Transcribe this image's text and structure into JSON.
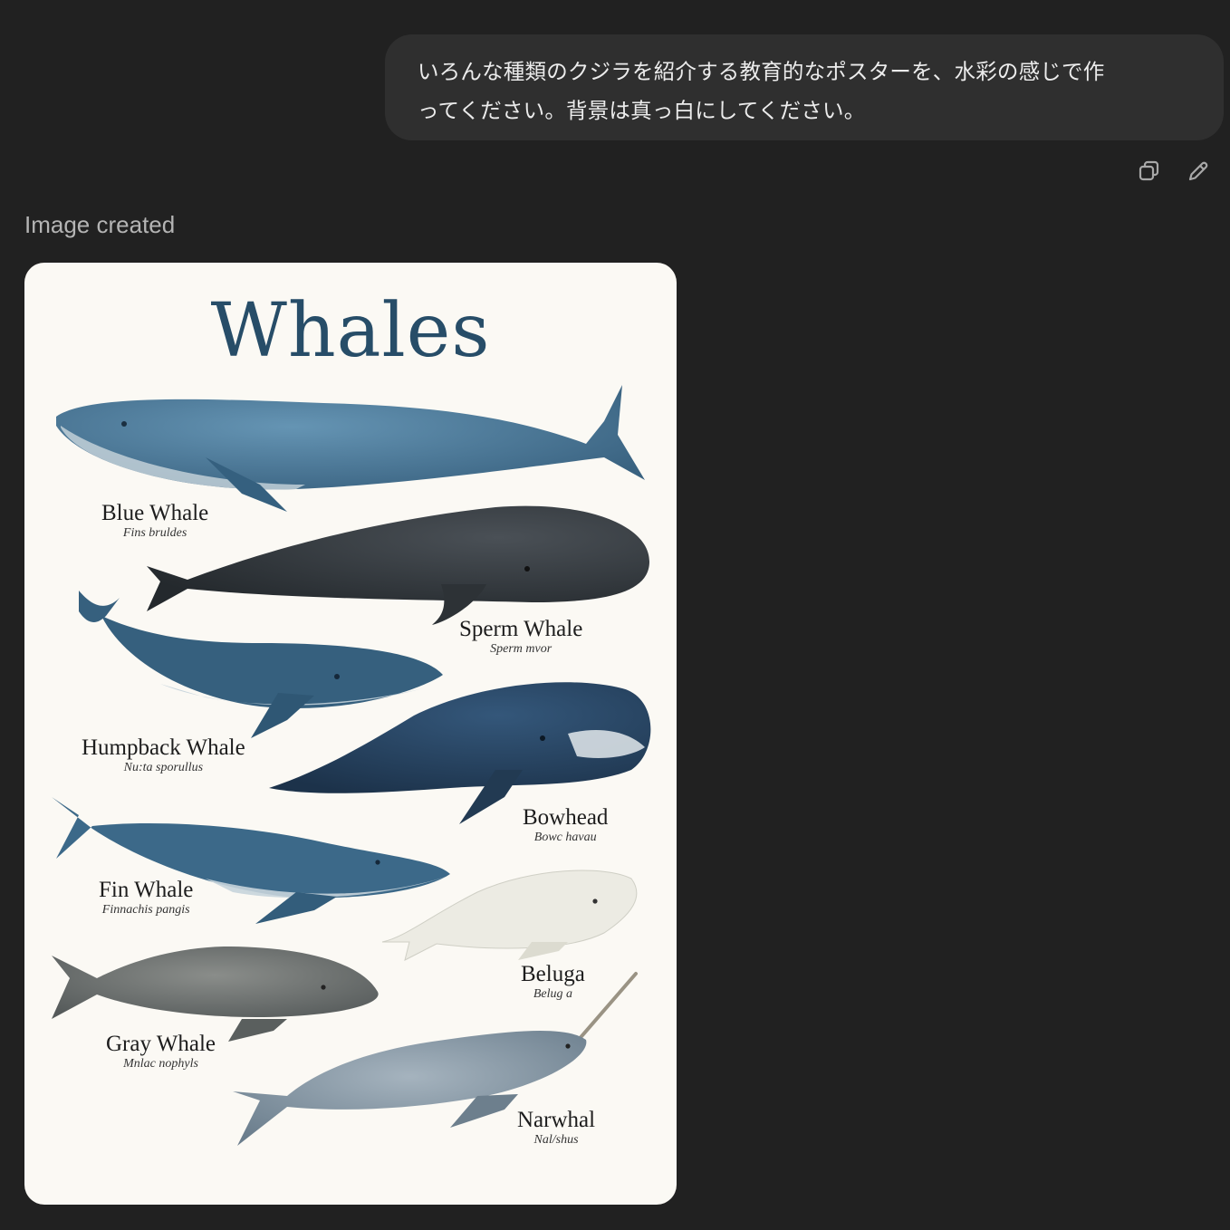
{
  "conversation": {
    "user_message_line1": "いろんな種類のクジラを紹介する教育的なポスターを、水彩の感じで作",
    "user_message_line2": "ってください。背景は真っ白にしてください。",
    "actions": {
      "copy_icon": "copy-icon",
      "edit_icon": "pencil-icon"
    }
  },
  "assistant": {
    "status": "Image created"
  },
  "poster": {
    "title": "Whales",
    "whales": [
      {
        "common": "Blue Whale",
        "latin": "Fins bruldes"
      },
      {
        "common": "Sperm Whale",
        "latin": "Sperm mvor"
      },
      {
        "common": "Humpback Whale",
        "latin": "Nu:ta sporullus"
      },
      {
        "common": "Bowhead",
        "latin": "Bowc havau"
      },
      {
        "common": "Fin Whale",
        "latin": "Finnachis pangis"
      },
      {
        "common": "Beluga",
        "latin": "Belug a"
      },
      {
        "common": "Gray Whale",
        "latin": "Mnlac nophyls"
      },
      {
        "common": "Narwhal",
        "latin": "Nal/shus"
      }
    ],
    "colors": {
      "background": "#fbf9f4",
      "title": "#274d68",
      "blue_whale": "#3f6f91",
      "sperm_whale": "#34393e",
      "humpback": "#36607e",
      "bowhead": "#253f58",
      "fin_whale": "#3c6989",
      "beluga": "#ecebe3",
      "gray_whale": "#6c6f6e",
      "narwhal": "#7d8e9b"
    }
  }
}
